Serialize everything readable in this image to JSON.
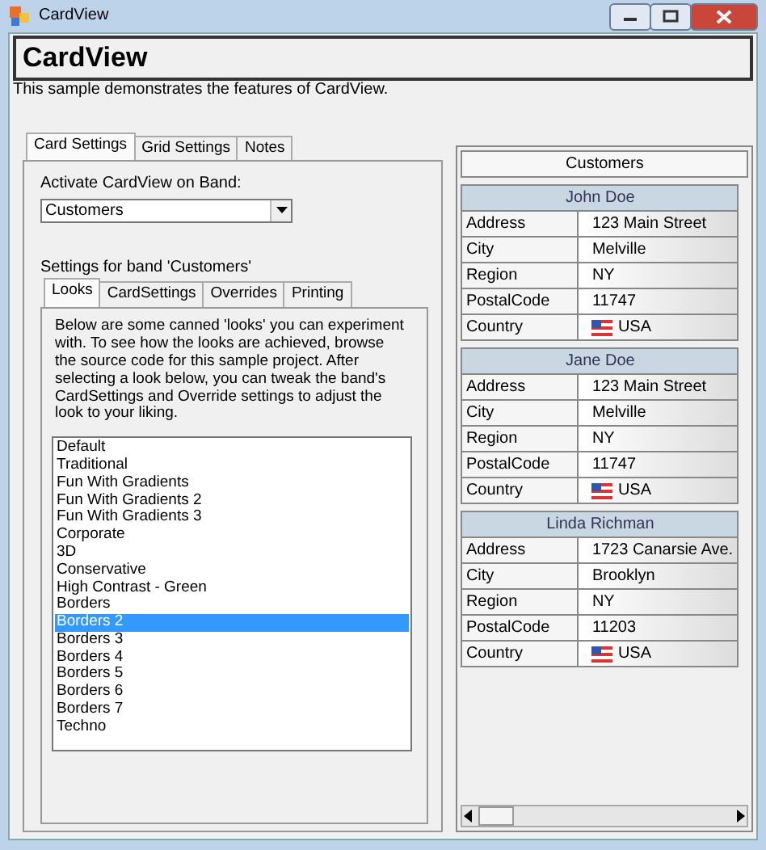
{
  "window": {
    "title": "CardView"
  },
  "header": {
    "title": "CardView",
    "description": "This sample demonstrates the features of CardView."
  },
  "tabs": [
    {
      "label": "Card Settings",
      "selected": true
    },
    {
      "label": "Grid Settings",
      "selected": false
    },
    {
      "label": "Notes",
      "selected": false
    }
  ],
  "band_field": {
    "label": "Activate CardView on Band:",
    "value": "Customers"
  },
  "band_settings_label": "Settings for band 'Customers'",
  "band_tabs": [
    {
      "label": "Looks",
      "selected": true
    },
    {
      "label": "CardSettings",
      "selected": false
    },
    {
      "label": "Overrides",
      "selected": false
    },
    {
      "label": "Printing",
      "selected": false
    }
  ],
  "looks_description": "Below are some canned 'looks' you can experiment with.  To see how the looks are achieved, browse the source code for this sample project.  After selecting a look below, you can tweak the band's CardSettings and Override settings to adjust the look to your liking.",
  "looks": [
    {
      "label": "Default",
      "selected": false
    },
    {
      "label": "Traditional",
      "selected": false
    },
    {
      "label": "Fun With Gradients",
      "selected": false
    },
    {
      "label": "Fun With Gradients 2",
      "selected": false
    },
    {
      "label": "Fun With Gradients 3",
      "selected": false
    },
    {
      "label": "Corporate",
      "selected": false
    },
    {
      "label": "3D",
      "selected": false
    },
    {
      "label": "Conservative",
      "selected": false
    },
    {
      "label": "High Contrast - Green",
      "selected": false
    },
    {
      "label": "Borders",
      "selected": false
    },
    {
      "label": "Borders 2",
      "selected": true
    },
    {
      "label": "Borders 3",
      "selected": false
    },
    {
      "label": "Borders 4",
      "selected": false
    },
    {
      "label": "Borders 5",
      "selected": false
    },
    {
      "label": "Borders 6",
      "selected": false
    },
    {
      "label": "Borders 7",
      "selected": false
    },
    {
      "label": "Techno",
      "selected": false
    }
  ],
  "card_view": {
    "title": "Customers",
    "cards": [
      {
        "title": "John Doe",
        "fields": [
          {
            "label": "Address",
            "value": "123 Main Street",
            "flag": false
          },
          {
            "label": "City",
            "value": "Melville",
            "flag": false
          },
          {
            "label": "Region",
            "value": "NY",
            "flag": false
          },
          {
            "label": "PostalCode",
            "value": "11747",
            "flag": false
          },
          {
            "label": "Country",
            "value": "USA",
            "flag": true
          }
        ]
      },
      {
        "title": "Jane Doe",
        "fields": [
          {
            "label": "Address",
            "value": "123 Main Street",
            "flag": false
          },
          {
            "label": "City",
            "value": "Melville",
            "flag": false
          },
          {
            "label": "Region",
            "value": "NY",
            "flag": false
          },
          {
            "label": "PostalCode",
            "value": "11747",
            "flag": false
          },
          {
            "label": "Country",
            "value": "USA",
            "flag": true
          }
        ]
      },
      {
        "title": "Linda Richman",
        "fields": [
          {
            "label": "Address",
            "value": "1723 Canarsie Ave.",
            "flag": false
          },
          {
            "label": "City",
            "value": "Brooklyn",
            "flag": false
          },
          {
            "label": "Region",
            "value": "NY",
            "flag": false
          },
          {
            "label": "PostalCode",
            "value": "11203",
            "flag": false
          },
          {
            "label": "Country",
            "value": "USA",
            "flag": true
          }
        ]
      }
    ]
  }
}
